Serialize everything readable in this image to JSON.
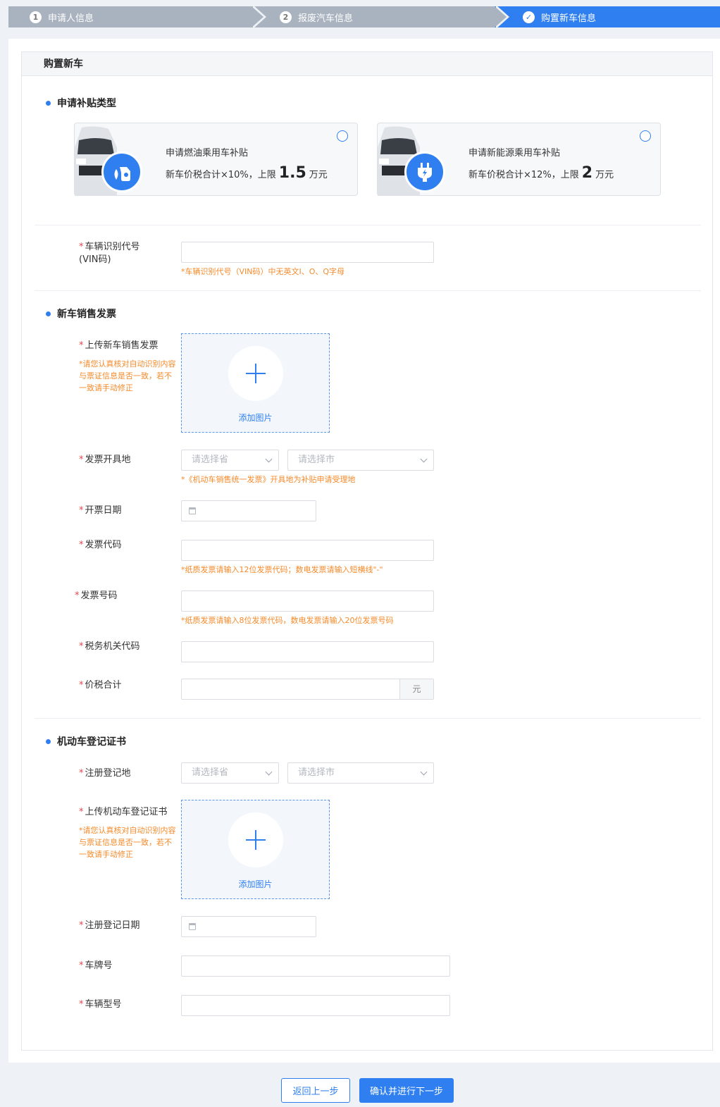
{
  "steps": [
    {
      "num": "1",
      "label": "申请人信息"
    },
    {
      "num": "2",
      "label": "报废汽车信息"
    },
    {
      "num": "✓",
      "label": "购置新车信息"
    }
  ],
  "card_title": "购置新车",
  "subsidy": {
    "section_title": "申请补贴类型",
    "options": [
      {
        "title": "申请燃油乘用车补贴",
        "desc_prefix": "新车价税合计×10%，上限",
        "amount": "1.5",
        "unit": "万元",
        "icon": "fuel-pump-icon"
      },
      {
        "title": "申请新能源乘用车补贴",
        "desc_prefix": "新车价税合计×12%，上限",
        "amount": "2",
        "unit": "万元",
        "icon": "ev-plug-icon"
      }
    ]
  },
  "vin": {
    "label_line1": "车辆识别代号",
    "label_line2": "(VIN码)",
    "hint": "*车辆识别代号（VIN码）中无英文I、O、Q字母"
  },
  "invoice": {
    "section_title": "新车销售发票",
    "upload_label": "上传新车销售发票",
    "upload_hint": "*请您认真核对自动识别内容与票证信息是否一致，若不一致请手动修正",
    "upload_button": "添加图片",
    "place_label": "发票开具地",
    "province_placeholder": "请选择省",
    "city_placeholder": "请选择市",
    "place_hint": "*《机动车销售统一发票》开具地为补贴申请受理地",
    "date_label": "开票日期",
    "code_label": "发票代码",
    "code_hint": "*纸质发票请输入12位发票代码；数电发票请输入短横线\"-\"",
    "number_label": "发票号码",
    "number_hint": "*纸质发票请输入8位发票代码，数电发票请输入20位发票号码",
    "tax_label": "税务机关代码",
    "total_label": "价税合计",
    "total_unit": "元"
  },
  "registration": {
    "section_title": "机动车登记证书",
    "place_label": "注册登记地",
    "province_placeholder": "请选择省",
    "city_placeholder": "请选择市",
    "upload_label": "上传机动车登记证书",
    "upload_hint": "*请您认真核对自动识别内容与票证信息是否一致，若不一致请手动修正",
    "upload_button": "添加图片",
    "date_label": "注册登记日期",
    "plate_label": "车牌号",
    "model_label": "车辆型号"
  },
  "buttons": {
    "back": "返回上一步",
    "next": "确认并进行下一步"
  },
  "colors": {
    "accent": "#2f7ff0",
    "hint": "#f58a2a",
    "required": "#e5484d"
  }
}
